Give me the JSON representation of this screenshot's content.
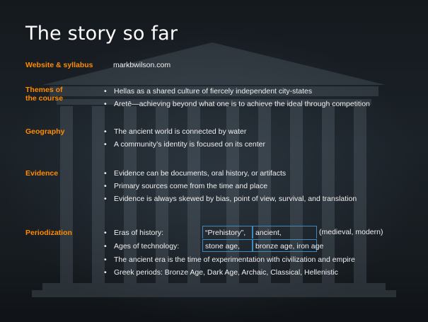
{
  "title": "The story so far",
  "sections": {
    "website": {
      "label": "Website & syllabus",
      "text": "markbwilson.com"
    },
    "themes": {
      "label_line1": "Themes of",
      "label_line2": "the course",
      "bullets": [
        "Hellas as a shared culture of fiercely independent city-states",
        "Aretē—achieving beyond what one is to achieve the ideal through competition"
      ]
    },
    "geography": {
      "label": "Geography",
      "bullets": [
        "The ancient world is connected by water",
        "A community’s identity is focused on its center"
      ]
    },
    "evidence": {
      "label": "Evidence",
      "bullets": [
        "Evidence can be documents, oral history, or artifacts",
        "Primary sources come from the time and place",
        "Evidence is always skewed by bias, point of view, survival, and translation"
      ]
    },
    "periodization": {
      "label": "Periodization",
      "table": [
        {
          "label": "Eras of history:",
          "cells": [
            "“Prehistory”,",
            "ancient,",
            "(medieval, modern)"
          ]
        },
        {
          "label": "Ages of technology:",
          "cells": [
            "stone age,",
            "bronze age, iron age",
            ""
          ]
        }
      ],
      "bullets": [
        "The ancient era is the time of experimentation with civilization and empire",
        "Greek periods: Bronze Age, Dark Age, Archaic, Classical, Hellenistic"
      ]
    }
  },
  "colors": {
    "accent": "#ff8c00",
    "table_border": "#3b8bc0",
    "text": "#f0f0f0",
    "title": "#ffffff"
  }
}
